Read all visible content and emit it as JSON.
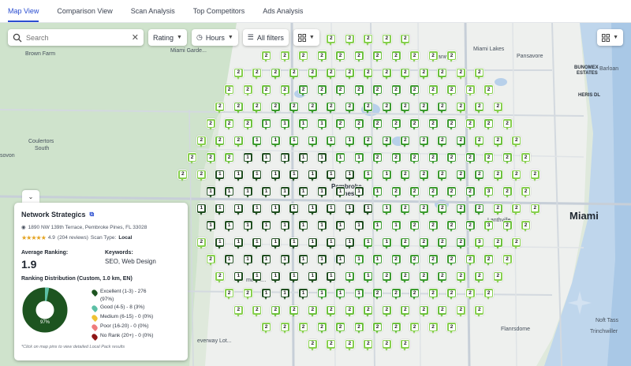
{
  "tabs": [
    {
      "label": "Map View",
      "active": true
    },
    {
      "label": "Comparison View",
      "active": false
    },
    {
      "label": "Scan Analysis",
      "active": false
    },
    {
      "label": "Top Competitors",
      "active": false
    },
    {
      "label": "Ads Analysis",
      "active": false
    }
  ],
  "toolbar": {
    "search_placeholder": "Search",
    "clear_glyph": "✕",
    "rating_label": "Rating",
    "hours_label": "Hours",
    "filters_label": "All filters",
    "grid_icon": "grid-icon"
  },
  "map_labels": {
    "brown_farm": "Brown Farm",
    "miami_gardens": "Miami Garde...",
    "miami_lakes": "Miami Lakes",
    "coulertors": "Coulertors",
    "south": "South",
    "sovon": "sovon",
    "hanwell": "Hanwell",
    "pansavore": "Pansavore",
    "bunomex": "BUNOMEX",
    "estates": "ESTATES",
    "barloan": "Barloan",
    "heris_dl": "HERIS DL",
    "pembroke": "Pembroke",
    "pines": "Pines",
    "lanthville": "Lanthville",
    "miami": "Miami",
    "lane": "me La...",
    "noft_tass": "Noft Tass",
    "trinchwiller": "Trinchwiller",
    "everway": "everway Lot...",
    "flanrsdome": "Flanrsdome"
  },
  "panel": {
    "business_name": "Network Strategics",
    "address": "1890 NW 139th Terrace, Pembroke Pines, FL 33028",
    "rating": "4.9",
    "reviews": "(204 reviews)",
    "scan_type_label": "Scan Type:",
    "scan_type": "Local",
    "avg_ranking_label": "Average Ranking:",
    "avg_ranking": "1.9",
    "keywords_label": "Keywords:",
    "keywords": "SEO, Web Design",
    "distribution_title": "Ranking Distribution (Custom, 1.0 km, EN)",
    "donut_label": "97%",
    "legend": [
      {
        "label": "Excellent (1-3) - 276",
        "pct": "(97%)",
        "color": "#1d5420"
      },
      {
        "label": "Good (4-5) - 8 (3%)",
        "color": "#5cbfa5"
      },
      {
        "label": "Medium (6-15) - 0 (0%)",
        "color": "#f0c233"
      },
      {
        "label": "Poor (16-20) - 0 (0%)",
        "color": "#ef7b7b"
      },
      {
        "label": "No Rank (20+) - 0 (0%)",
        "color": "#8e1515"
      }
    ],
    "footnote": "*Click on map pins to view detailed Local Pack results"
  },
  "colors": {
    "dark_pin": "#1f4d1f",
    "mid_pin": "#3b9a2e",
    "light_pin": "#6cc13c",
    "pale_pin": "#86cf4d",
    "accent": "#2a4dd0"
  }
}
